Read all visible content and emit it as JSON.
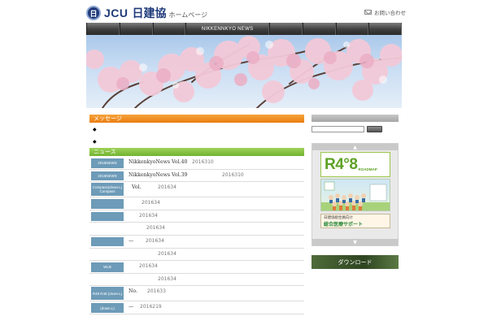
{
  "header": {
    "logo_jcu": "JCU",
    "logo_ja": "日建協",
    "logo_sub": "ホームページ",
    "contact_label": "お問い合わせ"
  },
  "nav": {
    "items": [
      "",
      "",
      "",
      "NIKKENNKYO NEWS",
      "",
      "",
      "",
      ""
    ]
  },
  "message_section": {
    "title": "メッセージ",
    "bullets": [
      "◆",
      "◆"
    ]
  },
  "news_section": {
    "title": "ニュース",
    "rows": [
      {
        "tag": "2015NEWS",
        "text": "NikkenkyoNews Vol.40",
        "date": "2016310"
      },
      {
        "tag": "2015NEWS",
        "text": "NikkenkyoNews Vol.39",
        "date": "2016310"
      },
      {
        "tag": "Compass(down.L) Compass",
        "text": "Vol.",
        "date": "201634"
      },
      {
        "tag": "",
        "text": "",
        "date": "201634"
      },
      {
        "tag": "",
        "text": "",
        "date": "201634"
      },
      {
        "tag": "",
        "text": "",
        "date": "201634"
      },
      {
        "tag": "",
        "text": "—",
        "date": "201634"
      },
      {
        "tag": "",
        "text": "",
        "date": "201634"
      },
      {
        "tag": "WLB",
        "text": "",
        "date": "201634"
      },
      {
        "tag": "",
        "text": "",
        "date": "201634"
      },
      {
        "tag": "R48 R48 (down.L)",
        "text": "No.",
        "date": "201633"
      },
      {
        "tag": "(down.L)",
        "text": "—",
        "date": "2016219"
      }
    ]
  },
  "sidebar": {
    "search_placeholder": "",
    "roadmap_big": "R4°8",
    "roadmap_sub": "ROADMAP",
    "support_line1": "日建協組合員向け",
    "support_line2": "総合医療サポート",
    "arrow_up": "▲",
    "arrow_down": "▼",
    "download_label": "ダウンロード"
  },
  "colors": {
    "message_bar": "#ea7d12",
    "news_bar": "#72b32f",
    "news_tag": "#6d9bb8",
    "nav": "#3e3e3e",
    "brand": "#1f3a7a"
  }
}
